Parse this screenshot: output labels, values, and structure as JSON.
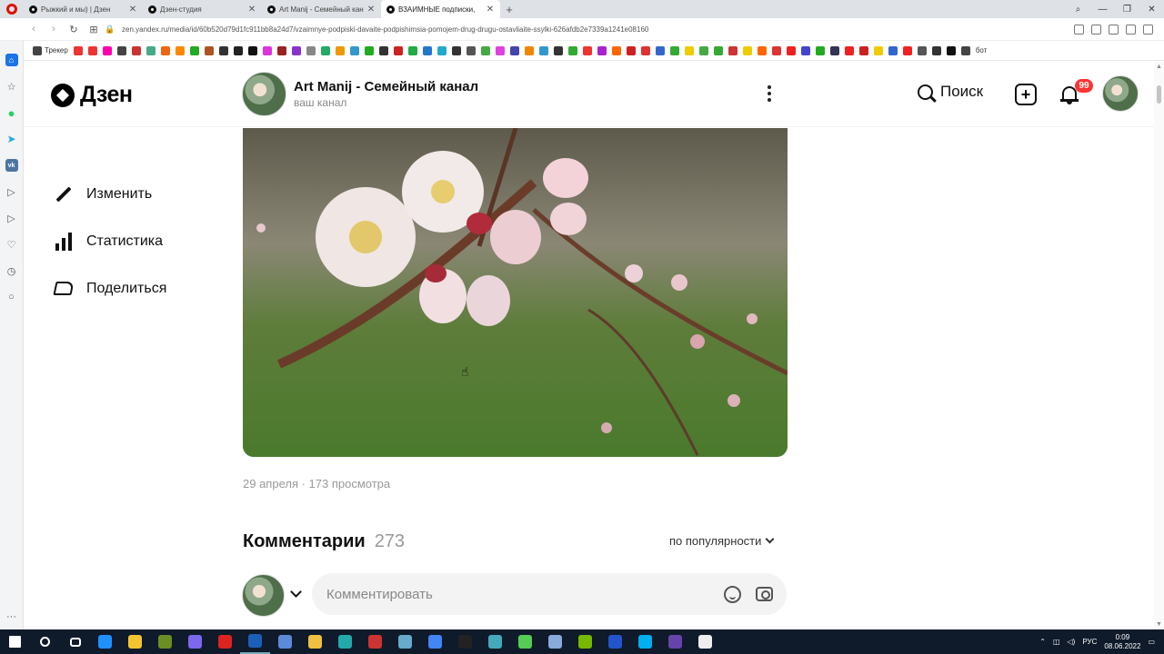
{
  "browser": {
    "tabs": [
      {
        "title": "Рыжкий и мы) | Дзен",
        "active": false
      },
      {
        "title": "Дзен-студия",
        "active": false
      },
      {
        "title": "Art Manij - Семейный кан",
        "active": false
      },
      {
        "title": "ВЗАИМНЫЕ подписки,",
        "active": true
      }
    ],
    "url": "zen.yandex.ru/media/id/60b520d79d1fc911bb8a24d7/vzaimnye-podpiski-davaite-podpishimsia-pomojem-drug-drugu-ostavliaite-ssylki-626afdb2e7339a1241e08160",
    "bookmarks_first": "Трекер",
    "bookmarks_bot": "бот"
  },
  "header": {
    "logo_text": "Дзен",
    "channel_name": "Art Manij - Семейный канал",
    "channel_sub": "ваш канал",
    "search_label": "Поиск",
    "notifications_count": "99"
  },
  "leftnav": {
    "edit": "Изменить",
    "stats": "Статистика",
    "share": "Поделиться"
  },
  "post": {
    "meta": "29 апреля · 173 просмотра"
  },
  "comments": {
    "title": "Комментарии",
    "count": "273",
    "sort_label": "по популярности",
    "input_placeholder": "Комментировать"
  },
  "taskbar": {
    "lang": "РУС",
    "time": "0:09",
    "date": "08.06.2022"
  },
  "colors": {
    "badge": "#ff3333",
    "accent_opera": "#dd1111"
  }
}
